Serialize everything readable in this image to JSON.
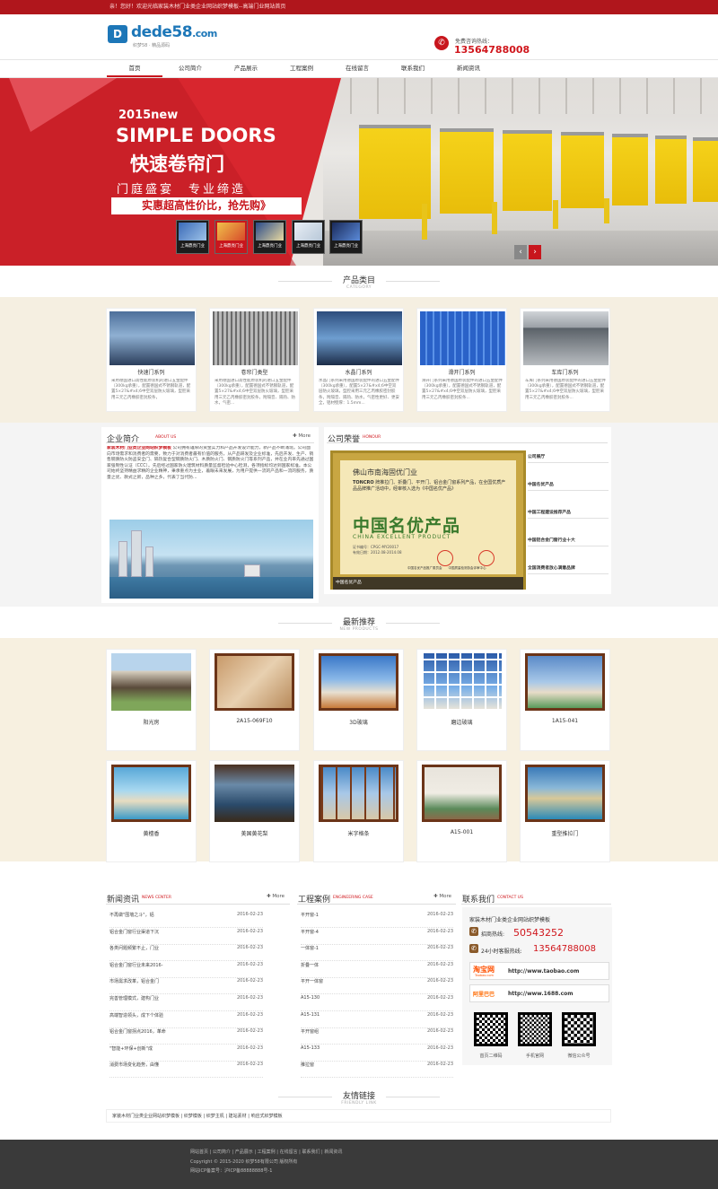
{
  "topbar": {
    "text": "亲！您好！欢迎光临家装木材门业类企业网站织梦模板--高端门业网站首页"
  },
  "header": {
    "logo_mark": "D",
    "logo_name": "dede",
    "logo_num": "58",
    "logo_tld": ".com",
    "logo_slogan": "织梦58 · 精品源码",
    "hotline_label": "免费咨询热线：",
    "hotline_number": "13564788008"
  },
  "nav": [
    "首页",
    "公司简介",
    "产品展示",
    "工程案例",
    "在线留言",
    "联系我们",
    "新闻资讯"
  ],
  "banner": {
    "line1": "2015new",
    "line2": "SIMPLE DOORS",
    "line3": "快速卷帘门",
    "slogan": "门庭盛宴　专业缔造",
    "cta": "实惠超高性价比，抢先购》",
    "thumb_label": "上海鼎亮门业",
    "prev": "‹",
    "next": "›"
  },
  "categories": {
    "title": "产品类目",
    "subtitle": "CATEGORY",
    "items": [
      {
        "name": "快速门系列",
        "desc": "采用德国进口高性能原装机的进口五金配件（300kg承重），配置德国式不锈钢轨道，配置5×27&#x4;6中空双层防火玻璃，型腔采用三元乙丙橡胶密封胶条，"
      },
      {
        "name": "卷帘门类型",
        "desc": "采用德国进口高性能原装机的进口五金配件（300kg承重），配置德国式不锈钢轨道，配置5×27&#x4;6中空双层防火玻璃，型腔采用三元乙丙橡胶密封胶条，附隔音、隔热、防水，气密..."
      },
      {
        "name": "水晶门系列",
        "desc": "水晶门系列采用德国原装配件的进口五金配件（300kg承重），配置5×27&#x4;6中空双层防火玻璃，型腔采用三元乙丙橡胶密封胶条，附隔音、隔热、防水，气密性更好、更安全，铝材壁厚：1.5mm..."
      },
      {
        "name": "滑开门系列",
        "desc": "滑开门系列采用德国原装配件的进口五金配件（300kg承重），配置德国式不锈钢轨道，配置5×27&#x4;6中空双层防火玻璃，型腔采用三元乙丙橡胶密封胶条..."
      },
      {
        "name": "车库门系列",
        "desc": "车库门系列采用德国原装配件的进口五金配件（300kg承重），配置德国式不锈钢轨道，配置5×27&#x4;6中空双层防火玻璃，型腔采用三元乙丙橡胶密封胶条..."
      }
    ]
  },
  "about": {
    "title": "企业简介",
    "en": "ABOUT US",
    "more": "More",
    "company": "家装木材门业类企业网站织梦模板",
    "text": "公司拥有雄厚的资金实力和产品开发设计能力，新产品不断涌现。公司面向市场需求和消费者的需要，致力于对消费者最有价值的服务，从产品研发及企业标准，先后开发、生产、销售钢质防火防盗安全门、隔热复合型钢质防火门、木质防火门、钢质防火门等系列产品，并在业内率先通过国家强制性认证（CCC）。先后经过国家防火建筑材料质量监督检验中心检测，各项指标均达到国家标准。本公司始终坚持精益求精的企业精神，秉承重点为主业，着眼未来发展，为用户提供一流的产品和一流的服务，质量之优、款式之新，品种之多，代表了当代防..."
  },
  "honor": {
    "title": "公司荣誉",
    "en": "HONOUR",
    "cert_company": "佛山市南海固优门业",
    "cert_brand": "TONCRO",
    "cert_text": "牌推拉门、折叠门、平开门、铝合金门窗系列产品，在全国优质产品品牌推广活动中，经审核入选为《中国名优产品》",
    "cert_big": "中国名优产品",
    "cert_en": "CHINA EXCELLENT PRODUCT",
    "cert_no": "证书编号：CPGC-MY20017",
    "cert_date": "有效日期：2012.08-2014.08",
    "cert_issuer": "中国名优产品推广委员会　　中国质量检测协会评审中心",
    "caption": "中国名优产品",
    "list": [
      "公司展厅",
      "中国名优产品",
      "中国工程建设推荐产品",
      "中国铝合金门窗行业十大",
      "全国消费者放心满意品牌"
    ]
  },
  "new_products": {
    "title": "最新推荐",
    "subtitle": "NEW PRODUCTS",
    "items": [
      "阳光房",
      "2A15-069F10",
      "3D玻璃",
      "磨边玻璃",
      "1A15-041",
      "黄檀香",
      "美国黄花梨",
      "米字格条",
      "A15-001",
      "重型推拉门"
    ]
  },
  "news": {
    "title": "新闻资讯",
    "en": "NEWS CENTER",
    "more": "More",
    "rows": [
      {
        "t": "不再做\"围墙之斗\"，铝",
        "d": "2016-02-23"
      },
      {
        "t": "铝合金门窗行业渠道下沉",
        "d": "2016-02-23"
      },
      {
        "t": "各类问题频繁不止，门业",
        "d": "2016-02-23"
      },
      {
        "t": "铝合金门窗行业未来2016-",
        "d": "2016-02-23"
      },
      {
        "t": "市场需求改革，铝合金门",
        "d": "2016-02-23"
      },
      {
        "t": "完善管理模式，建构门业",
        "d": "2016-02-23"
      },
      {
        "t": "高端智造领头，成下个体验",
        "d": "2016-02-23"
      },
      {
        "t": "铝合金门窗拐点2016，革命",
        "d": "2016-02-23"
      },
      {
        "t": "\"智能+环保+创新\"成",
        "d": "2016-02-23"
      },
      {
        "t": "消费市场变化趋势，由懂",
        "d": "2016-02-23"
      }
    ]
  },
  "cases": {
    "title": "工程案例",
    "en": "ENGINEERING CASE",
    "more": "More",
    "rows": [
      {
        "t": "平开窗-1",
        "d": "2016-02-23"
      },
      {
        "t": "平开窗-4",
        "d": "2016-02-23"
      },
      {
        "t": "一体窗-1",
        "d": "2016-02-23"
      },
      {
        "t": "折叠一体",
        "d": "2016-02-23"
      },
      {
        "t": "平开一体窗",
        "d": "2016-02-23"
      },
      {
        "t": "A15-130",
        "d": "2016-02-23"
      },
      {
        "t": "A15-131",
        "d": "2016-02-23"
      },
      {
        "t": "平开窗组",
        "d": "2016-02-23"
      },
      {
        "t": "A15-133",
        "d": "2016-02-23"
      },
      {
        "t": "推拉窗",
        "d": "2016-02-23"
      }
    ]
  },
  "contact": {
    "title": "联系我们",
    "en": "CONTACT US",
    "company": "家装木材门业类企业网站织梦模板",
    "biz_label": "招商热线:",
    "biz_number": "50543252",
    "service_label": "24小时客服热线:",
    "service_number": "13564788008",
    "taobao_logo": "淘宝网",
    "taobao_sub": "Taobao.com",
    "taobao_url": "http://www.taobao.com",
    "alibaba_logo": "阿里巴巴",
    "alibaba_url": "http://www.1688.com",
    "qr_labels": [
      "首页二维码",
      "手机官网",
      "微信公众号"
    ]
  },
  "friend_links": {
    "title": "友情链接",
    "subtitle": "FRIENDLY LINK",
    "items": [
      "家装木材门业类企业网站织梦模板",
      "织梦模板",
      "织梦主机",
      "建站素材",
      "响应式织梦模板"
    ]
  },
  "footer": {
    "nav": [
      "网站首页",
      "公司简介",
      "产品展示",
      "工程案例",
      "在线留言",
      "联系我们",
      "新闻资讯"
    ],
    "copyright": "Copyright © 2015-2020 织梦58有限公司 版权所有",
    "icp": "网站ICP备案号：沪ICP备88888888号-1"
  },
  "colors": {
    "brand_red": "#c8161d",
    "accent_blue": "#1d77b8",
    "beige": "#f5efe1",
    "footer": "#3a3a3a"
  }
}
